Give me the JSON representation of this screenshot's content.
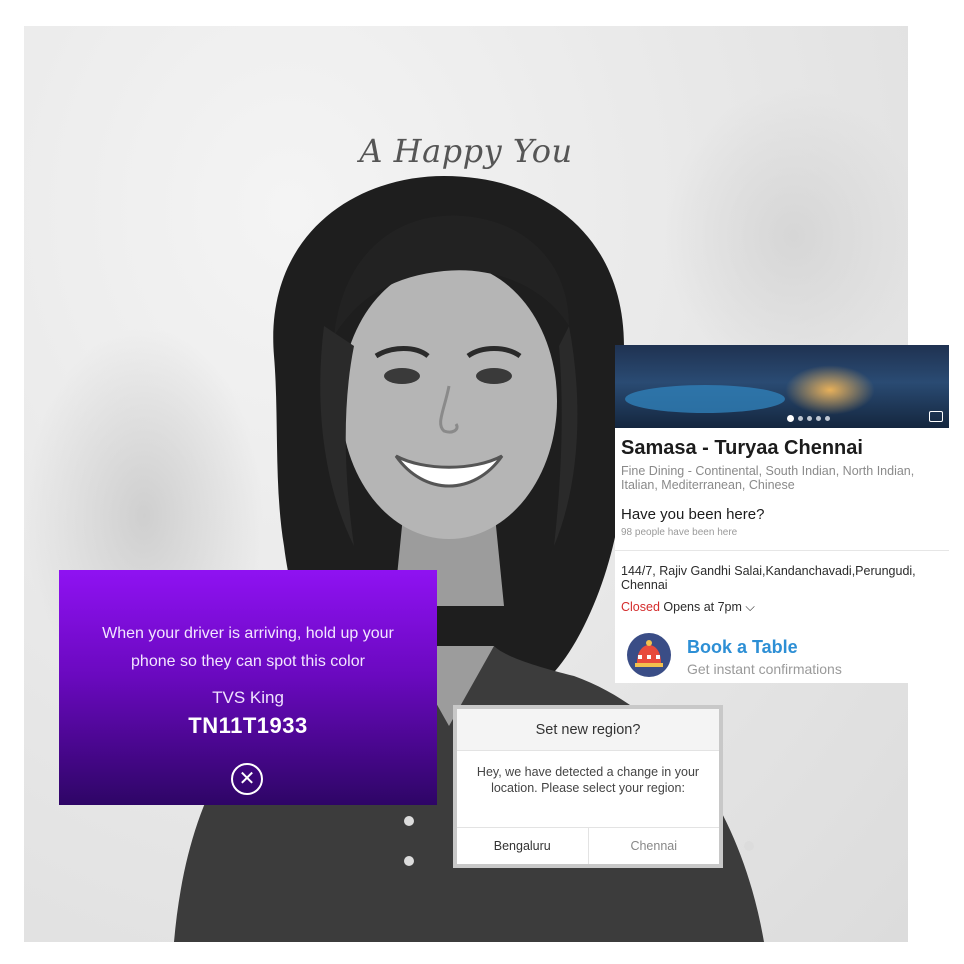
{
  "poster": {
    "headline": "A Happy You"
  },
  "uber_card": {
    "message": "When your driver is arriving, hold up your phone so they can spot this color",
    "vehicle_model": "TVS King",
    "plate_number": "TN11T1933",
    "close_icon": "close-circle-icon",
    "colors": {
      "top": "#8f12f2",
      "bottom": "#2e0566"
    }
  },
  "restaurant_card": {
    "name": "Samasa - Turyaa Chennai",
    "cuisine": "Fine Dining - Continental, South Indian, North Indian, Italian, Mediterranean, Chinese",
    "been_prompt": "Have you been here?",
    "been_count": "98 people have been here",
    "address": "144/7, Rajiv Gandhi Salai,Kandanchavadi,Perungudi, Chennai",
    "status": "Closed",
    "opens": "Opens at 7pm",
    "book": {
      "title": "Book a Table",
      "subtitle": "Get instant confirmations",
      "icon": "table-booking-icon"
    },
    "colors": {
      "closed": "#d42c2c",
      "book": "#2d8fd5"
    }
  },
  "region_dialog": {
    "title": "Set new region?",
    "body": "Hey, we have detected a change in your location. Please select your region:",
    "options": [
      "Bengaluru",
      "Chennai"
    ]
  }
}
